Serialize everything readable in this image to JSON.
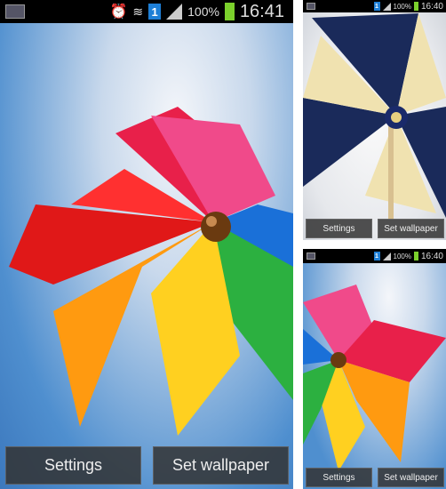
{
  "screens": [
    {
      "status": {
        "battery": "100%",
        "time": "16:41",
        "icons": [
          "gallery-icon",
          "alarm-icon",
          "wifi-icon",
          "sim-1-icon",
          "signal-icon",
          "battery-icon"
        ]
      },
      "buttons": {
        "settings": "Settings",
        "set_wallpaper": "Set wallpaper"
      }
    },
    {
      "status": {
        "battery": "100%",
        "time": "16:40"
      },
      "buttons": {
        "settings": "Settings",
        "set_wallpaper": "Set wallpaper"
      }
    },
    {
      "status": {
        "battery": "100%",
        "time": "16:40"
      },
      "buttons": {
        "settings": "Settings",
        "set_wallpaper": "Set wallpaper"
      }
    }
  ],
  "colors": {
    "sky": "#4f8fcf",
    "navy": "#1a2a5a",
    "cream": "#f0e2b0",
    "status_bar": "#000000",
    "battery": "#7bd02c"
  }
}
